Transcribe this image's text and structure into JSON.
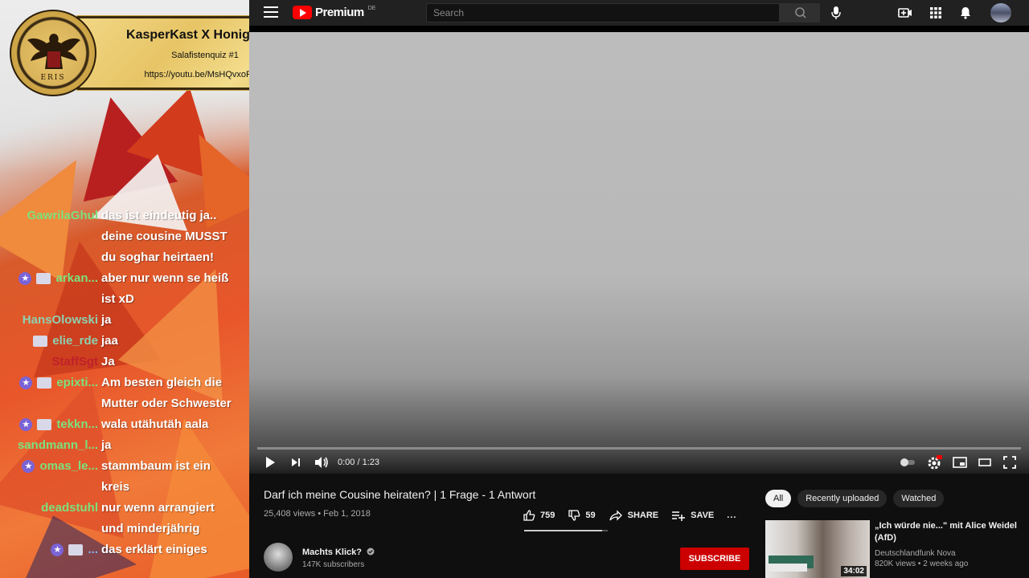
{
  "overlay": {
    "banner": {
      "title": "KasperKast X HonigWabe",
      "subtitle": "Salafistenquiz #1",
      "url": "https://youtu.be/MsHQvxoRszs"
    },
    "seal_text": "ERIS",
    "chat": [
      {
        "name": "GawrilaGhul",
        "badges": [],
        "color": "#7de07d",
        "lines": [
          "das ist eindeutig ja..",
          "deine cousine MUSST",
          "du soghar heirtaen!"
        ]
      },
      {
        "name": "arkan...",
        "badges": [
          "star",
          "box"
        ],
        "color": "#7de07d",
        "lines": [
          "aber nur wenn se heiß",
          "ist xD"
        ]
      },
      {
        "name": "HansOlowski",
        "badges": [],
        "color": "#8ed0b0",
        "lines": [
          "ja"
        ]
      },
      {
        "name": "elie_rde",
        "badges": [
          "box"
        ],
        "color": "#8ed0b0",
        "lines": [
          "jaa"
        ]
      },
      {
        "name": "StaffSgt",
        "badges": [],
        "color": "#c0202a",
        "lines": [
          "Ja"
        ]
      },
      {
        "name": "epixti...",
        "badges": [
          "star",
          "box"
        ],
        "color": "#7de07d",
        "lines": [
          "Am besten gleich die",
          "Mutter oder Schwester"
        ]
      },
      {
        "name": "tekkn...",
        "badges": [
          "star",
          "box"
        ],
        "color": "#7de07d",
        "lines": [
          "wala utähutäh aala"
        ]
      },
      {
        "name": "sandmann_l...",
        "badges": [],
        "color": "#7de07d",
        "lines": [
          "ja"
        ]
      },
      {
        "name": "omas_le...",
        "badges": [
          "star"
        ],
        "color": "#7de07d",
        "lines": [
          "stammbaum ist ein",
          "kreis"
        ]
      },
      {
        "name": "deadstuhl",
        "badges": [],
        "color": "#7de07d",
        "lines": [
          "nur wenn arrangiert",
          "und minderjährig"
        ]
      },
      {
        "name": "...",
        "badges": [
          "star",
          "box"
        ],
        "color": "#7fb4ff",
        "lines": [
          "das erklärt einiges"
        ]
      }
    ]
  },
  "youtube": {
    "logo_text": "Premium",
    "region": "DE",
    "search_placeholder": "Search",
    "player": {
      "time": "0:00 / 1:23",
      "progress": 0
    },
    "video": {
      "title": "Darf ich meine Cousine heiraten? | 1 Frage - 1 Antwort",
      "meta": "25,408 views • Feb 1, 2018",
      "likes": "759",
      "dislikes": "59",
      "like_ratio": 0.93,
      "share_label": "SHARE",
      "save_label": "SAVE",
      "more_label": "..."
    },
    "channel": {
      "name": "Machts Klick?",
      "subscribers": "147K subscribers",
      "subscribe_label": "SUBSCRIBE"
    },
    "sidebar": {
      "chips": [
        "All",
        "Recently uploaded",
        "Watched"
      ],
      "recommendation": {
        "title": "„Ich würde nie...\" mit Alice Weidel (AfD)",
        "channel": "Deutschlandfunk Nova",
        "meta": "820K views • 2 weeks ago",
        "duration": "34:02"
      }
    },
    "colors": {
      "subscribe": "#cc0000",
      "logo": "#ff0000"
    }
  }
}
